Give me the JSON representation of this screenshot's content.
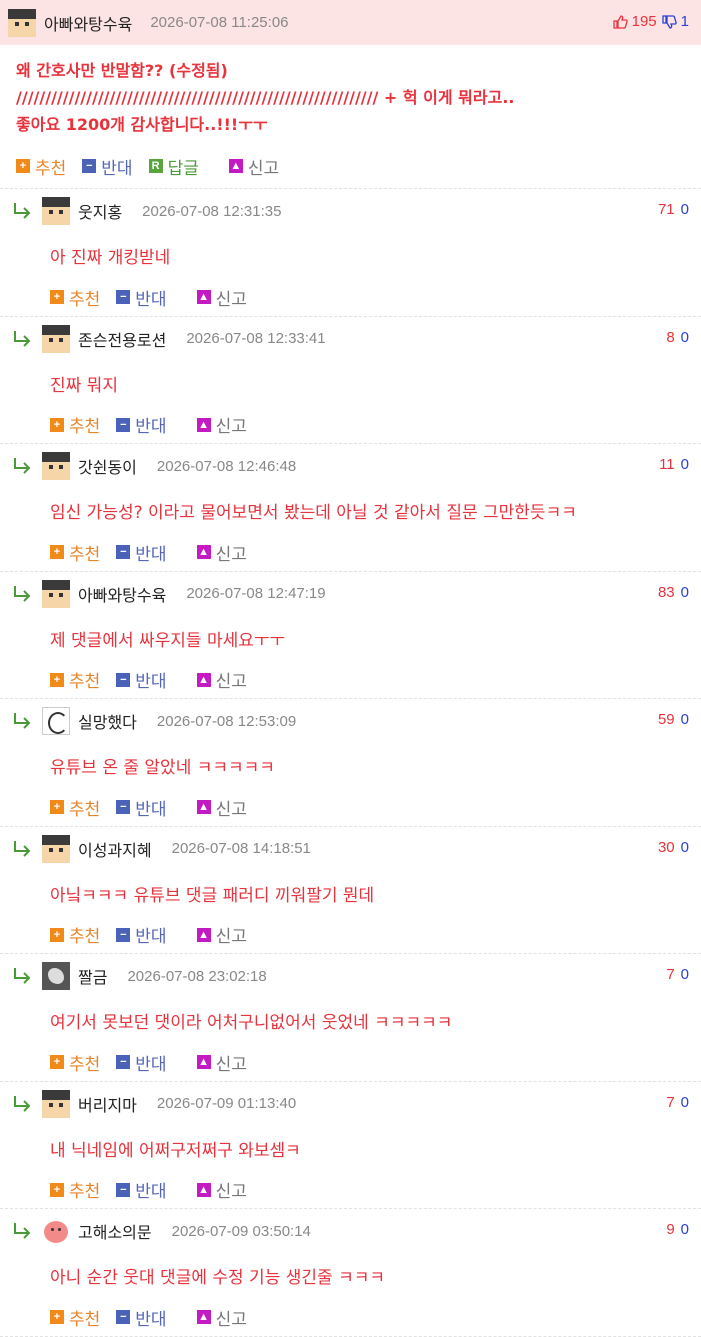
{
  "post": {
    "author": "아빠와탕수육",
    "avatar": "face-avatar",
    "time": "2026-07-08 11:25:06",
    "up": "195",
    "down": "1",
    "title_line1": "왜 간호사만 반말함?? (수정됨)",
    "title_line2": "////////////////////////////////////////////////////////////// + 헉 이게 뭐라고..",
    "title_line3": "좋아요 1200개 감사합니다..!!!ㅜㅜ",
    "actions": {
      "recommend": "추천",
      "oppose": "반대",
      "reply": "답글",
      "report": "신고"
    }
  },
  "comment_actions": {
    "recommend": "추천",
    "oppose": "반대",
    "report": "신고"
  },
  "comments": [
    {
      "author": "웃지홍",
      "avatar": "face-avatar",
      "time": "2026-07-08 12:31:35",
      "up": "71",
      "down": "0",
      "text": "아 진짜 개킹받네"
    },
    {
      "author": "존슨전용로션",
      "avatar": "face-avatar",
      "time": "2026-07-08 12:33:41",
      "up": "8",
      "down": "0",
      "text": "진짜 뭐지"
    },
    {
      "author": "갓쉰동이",
      "avatar": "face-avatar",
      "time": "2026-07-08 12:46:48",
      "up": "11",
      "down": "0",
      "text": "임신 가능성? 이라고 물어보면서 봤는데 아닐 것 같아서 질문 그만한듯ㅋㅋ"
    },
    {
      "author": "아빠와탕수육",
      "avatar": "face-avatar",
      "time": "2026-07-08 12:47:19",
      "up": "83",
      "down": "0",
      "text": "제 댓글에서 싸우지들 마세요ㅜㅜ"
    },
    {
      "author": "실망했다",
      "avatar": "sketch-avatar",
      "time": "2026-07-08 12:53:09",
      "up": "59",
      "down": "0",
      "text": "유튜브 온 줄 알았네 ㅋㅋㅋㅋㅋ"
    },
    {
      "author": "이성과지혜",
      "avatar": "face-avatar",
      "time": "2026-07-08 14:18:51",
      "up": "30",
      "down": "0",
      "text": "아닠ㅋㅋㅋ 유튜브 댓글 패러디 끼워팔기 뭔데"
    },
    {
      "author": "짤금",
      "avatar": "dark-avatar",
      "time": "2026-07-08 23:02:18",
      "up": "7",
      "down": "0",
      "text": "여기서 못보던 댓이라 어처구니없어서 웃었네 ㅋㅋㅋㅋㅋ"
    },
    {
      "author": "버리지마",
      "avatar": "face-avatar",
      "time": "2026-07-09 01:13:40",
      "up": "7",
      "down": "0",
      "text": "내 닉네임에 어쩌구저쩌구 와보셈ㅋ"
    },
    {
      "author": "고해소의문",
      "avatar": "pink-avatar",
      "time": "2026-07-09 03:50:14",
      "up": "9",
      "down": "0",
      "text": "아니 순간 웃대 댓글에 수정 기능 생긴줄 ㅋㅋㅋ"
    }
  ]
}
